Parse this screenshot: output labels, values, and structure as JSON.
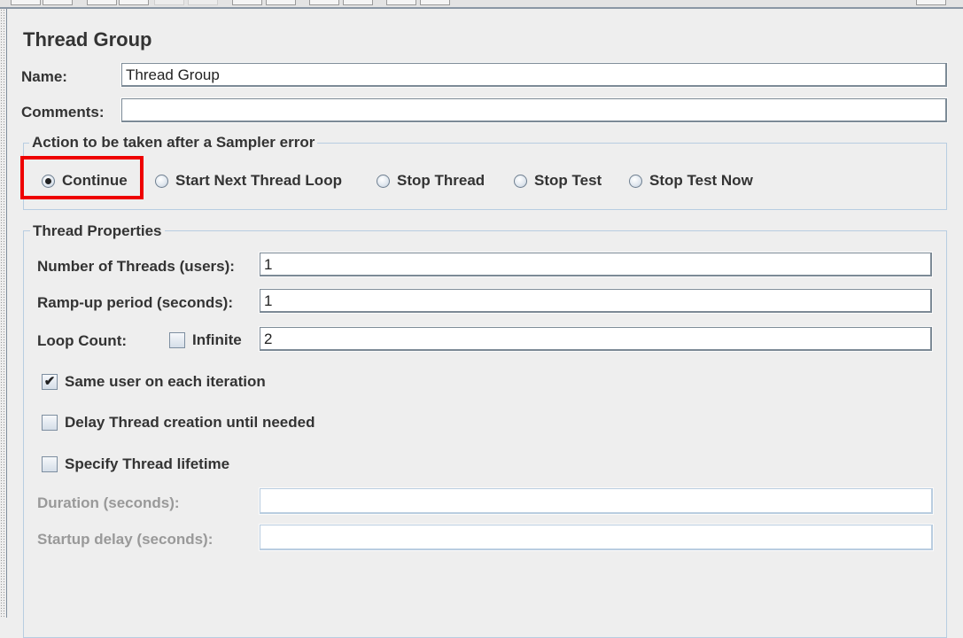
{
  "panel": {
    "title": "Thread Group",
    "name_label": "Name:",
    "name_value": "Thread Group",
    "comments_label": "Comments:",
    "comments_value": ""
  },
  "sampler_error": {
    "legend": "Action to be taken after a Sampler error",
    "options": [
      {
        "label": "Continue",
        "selected": true
      },
      {
        "label": "Start Next Thread Loop",
        "selected": false
      },
      {
        "label": "Stop Thread",
        "selected": false
      },
      {
        "label": "Stop Test",
        "selected": false
      },
      {
        "label": "Stop Test Now",
        "selected": false
      }
    ],
    "highlight_color": "#ee0000"
  },
  "thread_properties": {
    "legend": "Thread Properties",
    "num_threads_label": "Number of Threads (users):",
    "num_threads_value": "1",
    "rampup_label": "Ramp-up period (seconds):",
    "rampup_value": "1",
    "loop_count_label": "Loop Count:",
    "infinite_label": "Infinite",
    "infinite_checked": false,
    "loop_count_value": "2",
    "same_user_label": "Same user on each iteration",
    "same_user_checked": true,
    "delay_creation_label": "Delay Thread creation until needed",
    "delay_creation_checked": false,
    "lifetime_label": "Specify Thread lifetime",
    "lifetime_checked": false,
    "duration_label": "Duration (seconds):",
    "duration_value": "",
    "startup_delay_label": "Startup delay (seconds):",
    "startup_delay_value": "",
    "check_mark": "✔"
  }
}
